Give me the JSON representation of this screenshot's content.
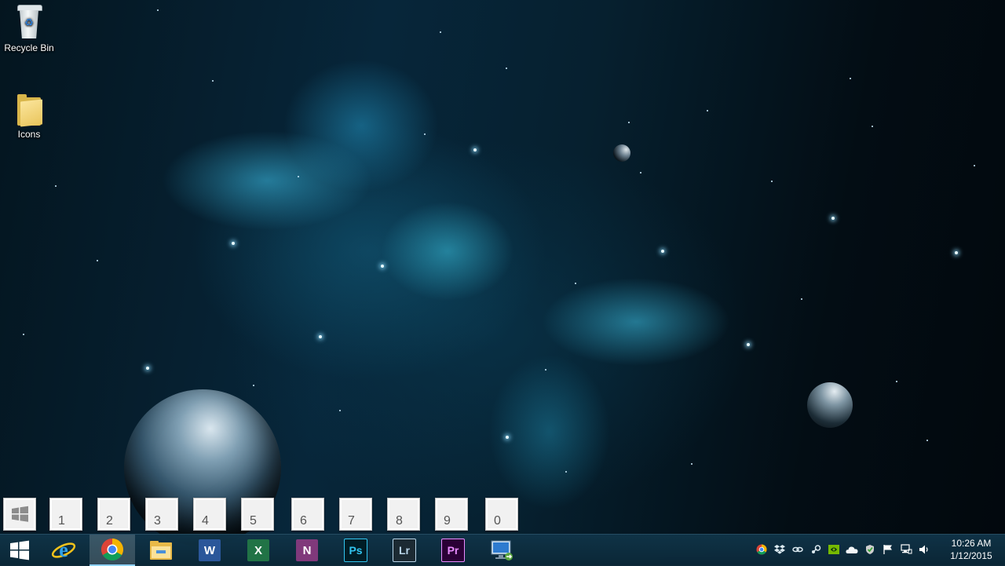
{
  "desktop": {
    "icons": [
      {
        "label": "Recycle Bin",
        "icon": "recycle-bin-icon"
      },
      {
        "label": "Icons",
        "icon": "folder-icon"
      }
    ]
  },
  "pager": {
    "start_icon": "windows-logo-icon",
    "desktops": [
      "1",
      "2",
      "3",
      "4",
      "5",
      "6",
      "7",
      "8",
      "9",
      "0"
    ]
  },
  "taskbar": {
    "start_icon": "windows-start-icon",
    "pinned": [
      {
        "name": "internet-explorer",
        "icon": "ie-icon",
        "glyph": "e",
        "active": false
      },
      {
        "name": "chrome",
        "icon": "chrome-icon",
        "glyph": "",
        "active": true
      },
      {
        "name": "file-explorer",
        "icon": "folder-icon",
        "glyph": "",
        "active": false
      },
      {
        "name": "word",
        "icon": "word-icon",
        "glyph": "W",
        "active": false
      },
      {
        "name": "excel",
        "icon": "excel-icon",
        "glyph": "X",
        "active": false
      },
      {
        "name": "onenote",
        "icon": "onenote-icon",
        "glyph": "N",
        "active": false
      },
      {
        "name": "photoshop",
        "icon": "photoshop-icon",
        "glyph": "Ps",
        "active": false
      },
      {
        "name": "lightroom",
        "icon": "lightroom-icon",
        "glyph": "Lr",
        "active": false
      },
      {
        "name": "premiere",
        "icon": "premiere-icon",
        "glyph": "Pr",
        "active": false
      },
      {
        "name": "remote-desktop",
        "icon": "remote-desktop-icon",
        "glyph": "",
        "active": false
      }
    ],
    "colors": {
      "word": "#2b579a",
      "excel": "#217346",
      "onenote": "#80397b",
      "photoshop_bg": "#001d26",
      "photoshop_fg": "#31c5f0",
      "lightroom_bg": "#1c2a33",
      "lightroom_fg": "#b8d4e8",
      "premiere_bg": "#2a0036",
      "premiere_fg": "#e88cff"
    }
  },
  "tray": {
    "icons": [
      "chrome-tray-icon",
      "dropbox-icon",
      "link-icon",
      "steam-icon",
      "nvidia-icon",
      "onedrive-icon",
      "shield-icon",
      "flag-icon",
      "network-icon",
      "volume-icon"
    ]
  },
  "clock": {
    "time": "10:26 AM",
    "date": "1/12/2015"
  }
}
